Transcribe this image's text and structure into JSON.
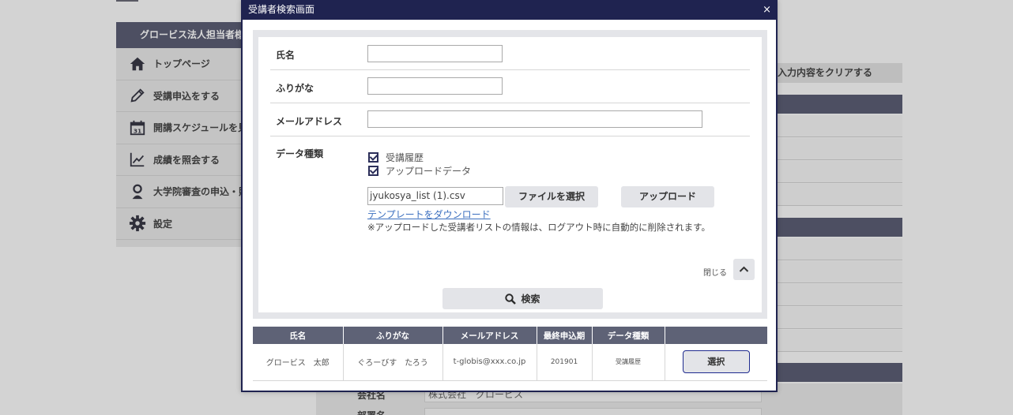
{
  "background": {
    "sidebar": {
      "title": "グロービス法人担当者様",
      "items": [
        {
          "label": "トップページ",
          "icon": "home-icon"
        },
        {
          "label": "受講申込をする",
          "icon": "pencil-icon"
        },
        {
          "label": "開講スケジュールを見る",
          "icon": "calendar-icon"
        },
        {
          "label": "成績を照会する",
          "icon": "chart-icon"
        },
        {
          "label": "大学院審査の申込・照会",
          "icon": "person-icon"
        },
        {
          "label": "設定",
          "icon": "gear-icon"
        }
      ]
    },
    "clear_button": "入力内容をクリアする",
    "company_label": "会社名",
    "company_value": "株式会社　グロービス",
    "dept_label": "部署名"
  },
  "modal": {
    "title": "受講者検索画面",
    "close_symbol": "×",
    "form": {
      "name_label": "氏名",
      "name_value": "",
      "furigana_label": "ふりがな",
      "furigana_value": "",
      "email_label": "メールアドレス",
      "email_value": "",
      "datatype_label": "データ種類",
      "checkboxes": [
        {
          "label": "受講履歴",
          "checked": true
        },
        {
          "label": "アップロードデータ",
          "checked": true
        }
      ],
      "file_name": "jyukosya_list (1).csv",
      "choose_file_button": "ファイルを選択",
      "upload_button": "アップロード",
      "template_link": "テンプレートをダウンロード",
      "note": "※アップロードした受講者リストの情報は、ログアウト時に自動的に削除されます。",
      "close_text": "閉じる",
      "search_button": "検索"
    },
    "results": {
      "headers": [
        "氏名",
        "ふりがな",
        "メールアドレス",
        "最終申込期",
        "データ種類",
        ""
      ],
      "rows": [
        {
          "name": "グロービス　太郎",
          "furigana": "ぐろーびす　たろう",
          "email": "t-globis@xxx.co.jp",
          "last_term": "201901",
          "data_type": "受講履歴",
          "action": "選択"
        }
      ]
    }
  },
  "colors": {
    "modal_header": "#1f2350",
    "table_header": "#5e6276",
    "button_gray": "#e3e4e8",
    "link": "#3b6fbf"
  }
}
